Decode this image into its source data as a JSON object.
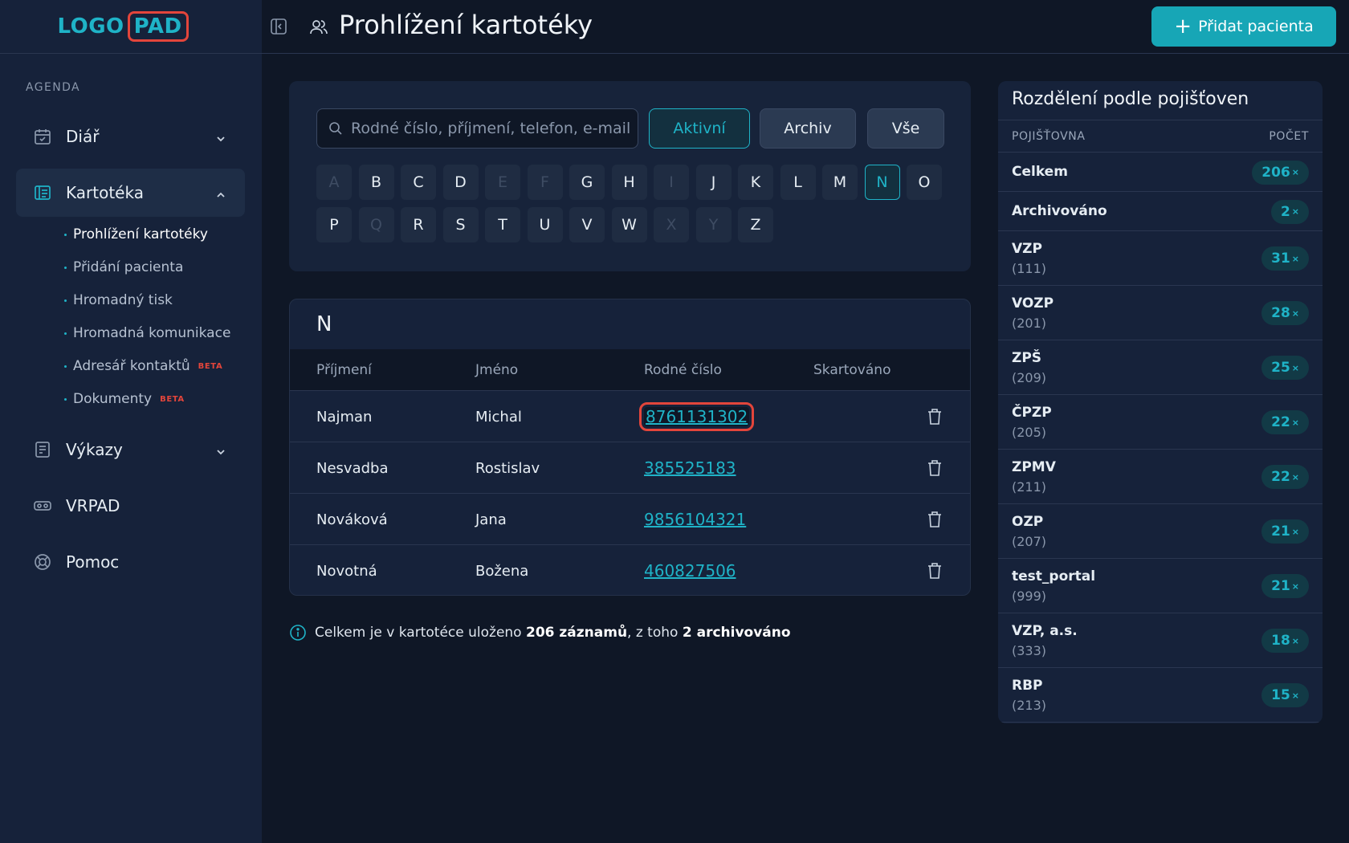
{
  "logo": {
    "part1": "LOGO",
    "part2": "PAD"
  },
  "sidebar": {
    "section_label": "AGENDA",
    "items": [
      {
        "label": "Diář"
      },
      {
        "label": "Kartotéka"
      },
      {
        "label": "Výkazy"
      },
      {
        "label": "VRPAD"
      },
      {
        "label": "Pomoc"
      }
    ],
    "sub_items": [
      {
        "label": "Prohlížení kartotéky"
      },
      {
        "label": "Přidání pacienta"
      },
      {
        "label": "Hromadný tisk"
      },
      {
        "label": "Hromadná komunikace"
      },
      {
        "label": "Adresář kontaktů",
        "badge": "BETA"
      },
      {
        "label": "Dokumenty",
        "badge": "BETA"
      }
    ]
  },
  "header": {
    "title": "Prohlížení kartotéky",
    "add_button": "Přidat pacienta"
  },
  "search": {
    "placeholder": "Rodné číslo, příjmení, telefon, e-mail",
    "value": "",
    "filters": [
      "Aktivní",
      "Archiv",
      "Vše"
    ],
    "active_filter": "Aktivní"
  },
  "letters": {
    "row1": [
      "A",
      "B",
      "C",
      "D",
      "E",
      "F",
      "G",
      "H",
      "I",
      "J",
      "K",
      "L",
      "M",
      "N",
      "O"
    ],
    "row2": [
      "P",
      "Q",
      "R",
      "S",
      "T",
      "U",
      "V",
      "W",
      "X",
      "Y",
      "Z"
    ],
    "disabled": [
      "A",
      "E",
      "F",
      "I",
      "Q",
      "X",
      "Y"
    ],
    "selected": "N"
  },
  "table": {
    "group_letter": "N",
    "headers": {
      "surname": "Příjmení",
      "name": "Jméno",
      "birth_number": "Rodné číslo",
      "shredded": "Skartováno"
    },
    "rows": [
      {
        "surname": "Najman",
        "name": "Michal",
        "birth_number": "8761131302",
        "shredded": ""
      },
      {
        "surname": "Nesvadba",
        "name": "Rostislav",
        "birth_number": "385525183",
        "shredded": ""
      },
      {
        "surname": "Nováková",
        "name": "Jana",
        "birth_number": "9856104321",
        "shredded": ""
      },
      {
        "surname": "Novotná",
        "name": "Božena",
        "birth_number": "460827506",
        "shredded": ""
      }
    ]
  },
  "info": {
    "prefix": "Celkem je v kartotéce uloženo",
    "total": "206 záznamů",
    "middle": ", z toho",
    "archived": "2 archivováno"
  },
  "insurance": {
    "title": "Rozdělení podle pojišťoven",
    "col_name": "POJIŠŤOVNA",
    "col_count": "POČET",
    "unit": "×",
    "rows": [
      {
        "name": "Celkem",
        "code": "",
        "count": "206"
      },
      {
        "name": "Archivováno",
        "code": "",
        "count": "2"
      },
      {
        "name": "VZP",
        "code": "(111)",
        "count": "31"
      },
      {
        "name": "VOZP",
        "code": "(201)",
        "count": "28"
      },
      {
        "name": "ZPŠ",
        "code": "(209)",
        "count": "25"
      },
      {
        "name": "ČPZP",
        "code": "(205)",
        "count": "22"
      },
      {
        "name": "ZPMV",
        "code": "(211)",
        "count": "22"
      },
      {
        "name": "OZP",
        "code": "(207)",
        "count": "21"
      },
      {
        "name": "test_portal",
        "code": "(999)",
        "count": "21"
      },
      {
        "name": "VZP, a.s.",
        "code": "(333)",
        "count": "18"
      },
      {
        "name": "RBP",
        "code": "(213)",
        "count": "15"
      }
    ]
  },
  "colors": {
    "accent": "#1fb3c7",
    "highlight": "#e3453b",
    "background": "#0f1726",
    "panel": "#16223a"
  }
}
